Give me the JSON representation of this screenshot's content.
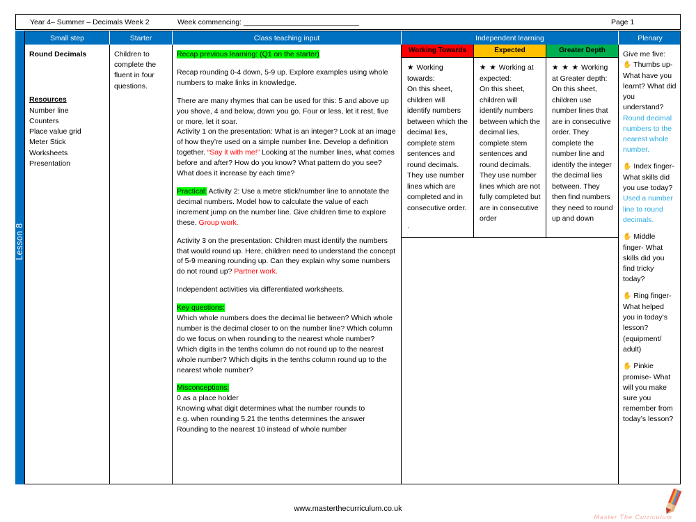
{
  "header": {
    "title": "Year 4– Summer – Decimals Week 2",
    "week_commencing_label": "Week commencing: ",
    "week_commencing_line": "_______________________________",
    "page": "Page 1"
  },
  "spine": {
    "lesson_label": "Lesson 8",
    "color": "#0070C0"
  },
  "columns": {
    "small_step": "Small step",
    "starter": "Starter",
    "class_teaching_input": "Class teaching input",
    "independent_learning": "Independent learning",
    "plenary": "Plenary"
  },
  "small_step": {
    "title": "Round Decimals",
    "resources_title": "Resources",
    "resources": [
      "Number line",
      "Counters",
      "Place value grid",
      "Meter Stick",
      "Worksheets",
      "Presentation"
    ]
  },
  "starter": {
    "text": "Children to complete the fluent in four questions."
  },
  "teaching": {
    "recap_heading": "Recap previous learning: (Q1 on the starter)",
    "recap_body": "Recap rounding 0-4 down, 5-9 up. Explore examples using whole numbers to make links in knowledge.",
    "rhymes": "There are many rhymes that can be used for this: 5 and above up you shove, 4 and below, down you go. Four or less, let it rest, five or more, let it soar.",
    "activity1_a": "Activity 1 on the presentation: What is an integer? Look at an image of how they’re used on a simple number line. Develop a definition together. ",
    "activity1_red": "“Say it with me!”",
    "activity1_b": "  Looking at the number lines, what comes before and after? How do you know? What pattern do you see? What does it increase by each time?",
    "practical_tag": "Practical:",
    "practical_body": " Activity 2: Use a metre stick/number line to annotate the decimal numbers. Model how to calculate the value of each increment jump on the number line. Give children time to explore these. ",
    "practical_red": "Group work.",
    "activity3_a": "Activity 3 on the presentation: Children must identify the numbers that would round up. Here, children need to understand the concept of 5-9 meaning rounding up. Can they explain why some numbers do not round up? ",
    "activity3_red": " Partner work.",
    "independent_line": "Independent activities via differentiated worksheets.",
    "key_questions_heading": "Key questions:",
    "key_questions_body": "Which whole numbers does the decimal lie between? Which whole number is the decimal closer to on the number line? Which column do we focus on when rounding to the nearest whole number? Which digits in the tenths column do not round up to the nearest whole number? Which digits in the tenths column round up to the nearest whole number?",
    "misconceptions_heading": "Misconceptions:",
    "misconceptions": [
      "0 as a place holder",
      "Knowing what digit determines what the number rounds to",
      "e.g. when rounding 5.21 the tenths determines the answer",
      "Rounding to the nearest 10 instead of whole number"
    ]
  },
  "independent": {
    "bands": [
      {
        "label": "Working Towards",
        "color": "#FF0000",
        "stars": "★",
        "lead": " Working towards:",
        "body": "On this sheet, children will identify numbers between which the decimal lies, complete stem sentences and round decimals. They use number lines which are completed and in consecutive order.",
        "trailing": "."
      },
      {
        "label": "Expected",
        "color": "#FFC000",
        "stars": "★ ★",
        "lead": " Working at expected:",
        "body": "On this sheet, children will identify numbers between which the decimal lies, complete stem sentences and round decimals. They use number lines which are not fully completed but are in consecutive order",
        "trailing": ""
      },
      {
        "label": "Greater Depth",
        "color": "#00B050",
        "stars": "★ ★ ★",
        "lead": " Working at Greater depth:",
        "body": "On this sheet, children use number lines that are in consecutive order. They complete the number line and identify the integer the decimal lies between. They then find numbers they need to round up and down",
        "trailing": ""
      }
    ]
  },
  "plenary": {
    "intro": "Give me five:",
    "hand_icon": "✋",
    "items": [
      {
        "prompt": " Thumbs up- What have you learnt? What did you understand?",
        "answer": "Round decimal numbers to the nearest whole number."
      },
      {
        "prompt": " Index finger- What skills did you use today?",
        "answer": "Used a number line to round decimals."
      },
      {
        "prompt": " Middle finger- What skills did you find tricky today?",
        "answer": ""
      },
      {
        "prompt": " Ring finger- What helped you in today’s lesson? (equipment/ adult)",
        "answer": ""
      },
      {
        "prompt": " Pinkie promise- What will you make sure you remember from today’s lesson?",
        "answer": ""
      }
    ],
    "answer_color": "#29ABE2"
  },
  "footer": {
    "url": "www.masterthecurriculum.co.uk",
    "logo_text": "Master The Curriculum"
  }
}
